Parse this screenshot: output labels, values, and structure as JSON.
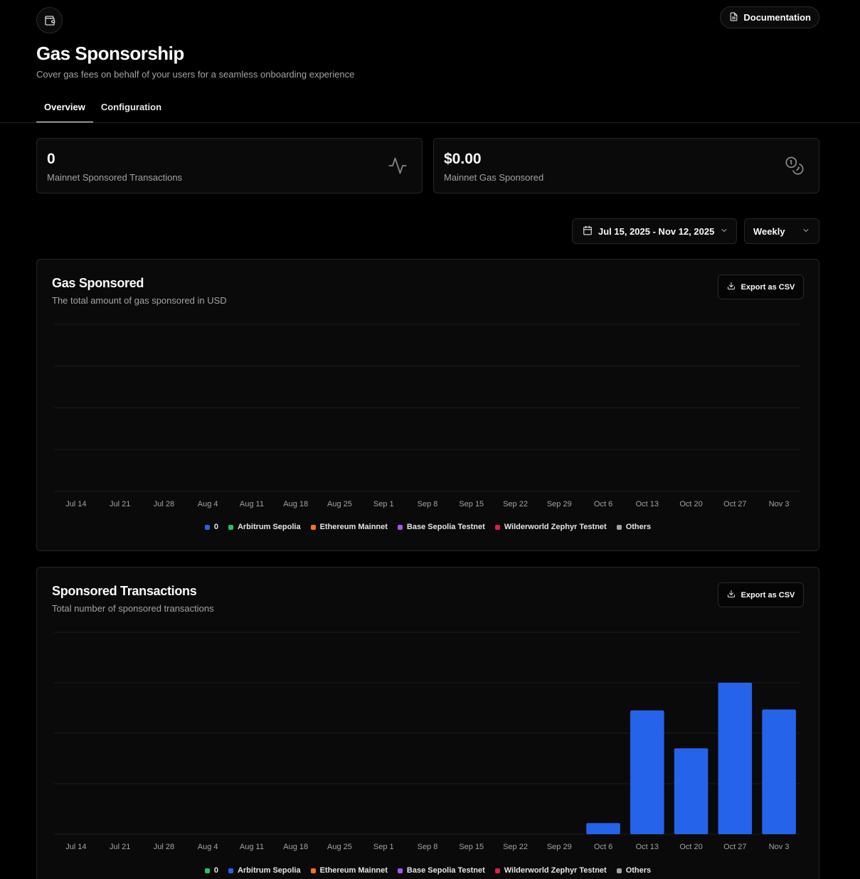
{
  "header": {
    "logo_icon": "wallet-icon",
    "documentation_label": "Documentation",
    "documentation_icon": "document-icon",
    "title": "Gas Sponsorship",
    "subtitle": "Cover gas fees on behalf of your users for a seamless onboarding experience"
  },
  "tabs": [
    {
      "label": "Overview",
      "active": true
    },
    {
      "label": "Configuration",
      "active": false
    }
  ],
  "stats": [
    {
      "value": "0",
      "label": "Mainnet Sponsored Transactions",
      "icon": "activity-icon"
    },
    {
      "value": "$0.00",
      "label": "Mainnet Gas Sponsored",
      "icon": "coins-icon"
    }
  ],
  "filters": {
    "date_range": "Jul 15, 2025 - Nov 12, 2025",
    "interval": "Weekly"
  },
  "export_label": "Export as CSV",
  "colors": {
    "blue": "#2563eb",
    "green": "#22c55e",
    "orange": "#f97316",
    "purple": "#a855f7",
    "red": "#e11d48",
    "gray": "#a3a3a3"
  },
  "gas_chart": {
    "title": "Gas Sponsored",
    "description": "The total amount of gas sponsored in USD",
    "legend": [
      {
        "label": "0",
        "color": "#2563eb"
      },
      {
        "label": "Arbitrum Sepolia",
        "color": "#22c55e"
      },
      {
        "label": "Ethereum Mainnet",
        "color": "#f97316"
      },
      {
        "label": "Base Sepolia Testnet",
        "color": "#a855f7"
      },
      {
        "label": "Wilderworld Zephyr Testnet",
        "color": "#e11d48"
      },
      {
        "label": "Others",
        "color": "#a3a3a3"
      }
    ]
  },
  "tx_chart": {
    "title": "Sponsored Transactions",
    "description": "Total number of sponsored transactions",
    "legend": [
      {
        "label": "0",
        "color": "#22c55e"
      },
      {
        "label": "Arbitrum Sepolia",
        "color": "#2563eb"
      },
      {
        "label": "Ethereum Mainnet",
        "color": "#f97316"
      },
      {
        "label": "Base Sepolia Testnet",
        "color": "#a855f7"
      },
      {
        "label": "Wilderworld Zephyr Testnet",
        "color": "#e11d48"
      },
      {
        "label": "Others",
        "color": "#a3a3a3"
      }
    ]
  },
  "chart_data": [
    {
      "type": "bar",
      "title": "Gas Sponsored",
      "categories": [
        "Jul 14",
        "Jul 21",
        "Jul 28",
        "Aug 4",
        "Aug 11",
        "Aug 18",
        "Aug 25",
        "Sep 1",
        "Sep 8",
        "Sep 15",
        "Sep 22",
        "Sep 29",
        "Oct 6",
        "Oct 13",
        "Oct 20",
        "Oct 27",
        "Nov 3"
      ],
      "series": [
        {
          "name": "0",
          "values": [
            0,
            0,
            0,
            0,
            0,
            0,
            0,
            0,
            0,
            0,
            0,
            0,
            0,
            0,
            0,
            0,
            0
          ]
        }
      ],
      "grid": true,
      "legend_position": "bottom",
      "ylim": [
        0,
        4
      ]
    },
    {
      "type": "bar",
      "title": "Sponsored Transactions",
      "categories": [
        "Jul 14",
        "Jul 21",
        "Jul 28",
        "Aug 4",
        "Aug 11",
        "Aug 18",
        "Aug 25",
        "Sep 1",
        "Sep 8",
        "Sep 15",
        "Sep 22",
        "Sep 29",
        "Oct 6",
        "Oct 13",
        "Oct 20",
        "Oct 27",
        "Nov 3"
      ],
      "series": [
        {
          "name": "Arbitrum Sepolia",
          "values": [
            0,
            0,
            0,
            0,
            0,
            0,
            0,
            0,
            0,
            0,
            0,
            0,
            0.22,
            2.45,
            1.7,
            3.0,
            2.47
          ]
        }
      ],
      "grid": true,
      "legend_position": "bottom",
      "ylim": [
        0,
        4
      ]
    }
  ]
}
